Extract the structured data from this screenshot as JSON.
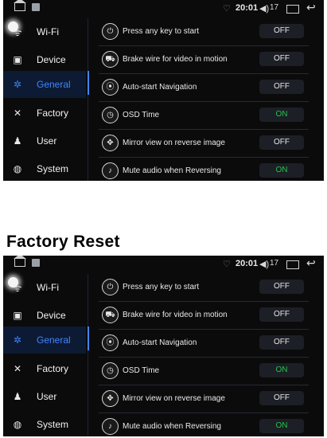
{
  "status": {
    "time": "20:01",
    "volume": "17"
  },
  "sidebar": {
    "items": [
      {
        "label": "Wi-Fi",
        "icon": "wifi-icon"
      },
      {
        "label": "Device",
        "icon": "device-icon"
      },
      {
        "label": "General",
        "icon": "gear-icon",
        "active": true
      },
      {
        "label": "Factory",
        "icon": "tools-icon"
      },
      {
        "label": "User",
        "icon": "user-icon"
      },
      {
        "label": "System",
        "icon": "globe-icon"
      }
    ]
  },
  "settings": [
    {
      "label": "Press any key to start",
      "value": "OFF",
      "icon": "power-icon"
    },
    {
      "label": "Brake wire for video in motion",
      "value": "OFF",
      "icon": "car-icon"
    },
    {
      "label": "Auto-start Navigation",
      "value": "OFF",
      "icon": "location-icon"
    },
    {
      "label": "OSD Time",
      "value": "ON",
      "icon": "clock-icon"
    },
    {
      "label": "Mirror view on reverse image",
      "value": "OFF",
      "icon": "mirror-icon"
    },
    {
      "label": "Mute audio when Reversing",
      "value": "ON",
      "icon": "mute-icon"
    }
  ],
  "heading": "Factory Reset",
  "colors": {
    "accent": "#3f86ff",
    "on": "#27c24c",
    "background": "#0b0b0c"
  }
}
